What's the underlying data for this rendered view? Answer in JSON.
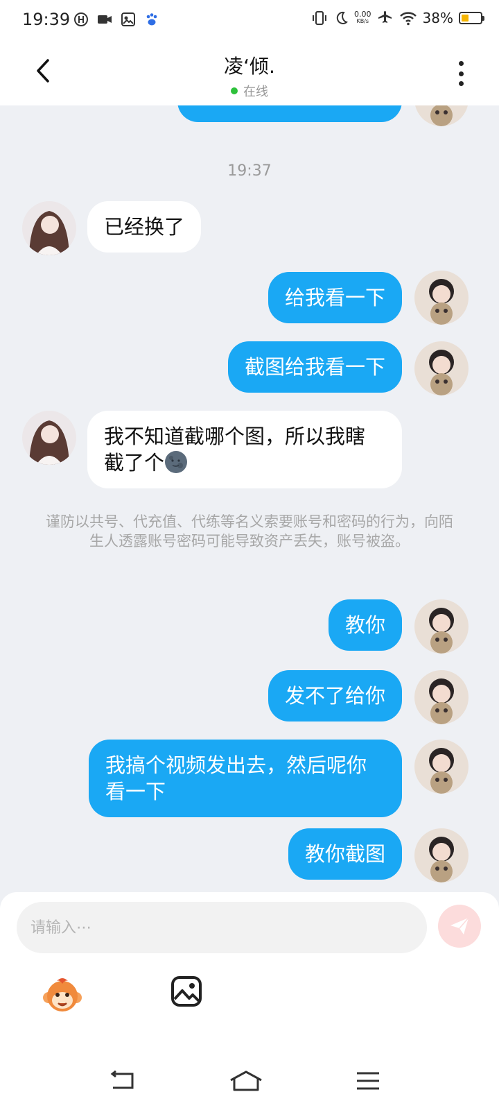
{
  "status_bar": {
    "time": "19:39",
    "net_speed_value": "0.00",
    "net_speed_unit": "KB/s",
    "battery_text": "38%",
    "battery_level": 0.38,
    "battery_color": "#f5b400"
  },
  "header": {
    "title": "凌‘倾.",
    "presence": "在线",
    "presence_color": "#2ec13b"
  },
  "messages": {
    "timestamp": "19:37",
    "items": [
      {
        "dir": "in",
        "text": "已经换了"
      },
      {
        "dir": "out",
        "text": "给我看一下"
      },
      {
        "dir": "out",
        "text": "截图给我看一下"
      },
      {
        "dir": "in",
        "text_line1": "我不知道截哪个图，所以我瞎",
        "text_line2": "截了个"
      },
      {
        "dir": "out",
        "text": "教你"
      },
      {
        "dir": "out",
        "text": "发不了给你"
      },
      {
        "dir": "out",
        "text_line1": "我搞个视频发出去，然后呢你",
        "text_line2": "看一下"
      },
      {
        "dir": "out",
        "text": "教你截图"
      }
    ],
    "notice": "谨防以共号、代充值、代练等名义索要账号和密码的行为，向陌生人透露账号密码可能导致资产丢失，账号被盗。",
    "outgoing_color": "#1aa8f4",
    "incoming_color": "#ffffff"
  },
  "input": {
    "placeholder": "请输入⋯"
  },
  "icons": {
    "emoji_tool": "monkey-emoji-icon",
    "image_tool": "image-icon",
    "send": "send-icon",
    "nav_back": "nav-back-icon",
    "nav_home": "nav-home-icon",
    "nav_menu": "nav-menu-icon"
  }
}
